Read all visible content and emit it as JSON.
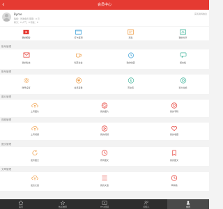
{
  "header": {
    "back_icon": "chevron-left-icon",
    "title": "会员中心"
  },
  "profile": {
    "name": "Byme",
    "line1": "等级：普通会员    蛋蛋：0 元",
    "line2": "积分：0   人气：0   粉丝：0",
    "edit_label": "完善资料信息"
  },
  "quick_actions": [
    {
      "label": "我的橱窗",
      "icon": "video-icon"
    },
    {
      "label": "打卡签到",
      "icon": "calendar-icon"
    },
    {
      "label": "消息",
      "icon": "message-icon"
    },
    {
      "label": "我的分享",
      "icon": "share-icon"
    }
  ],
  "sections": [
    {
      "title": "账号管理",
      "items": [
        {
          "label": "我的私信",
          "icon": "mail-icon"
        },
        {
          "label": "喝茶社会",
          "icon": "cup-icon"
        },
        {
          "label": "我的收藏",
          "icon": "history-icon"
        },
        {
          "label": "留言板",
          "icon": "message-icon"
        }
      ]
    },
    {
      "title": "账号管理",
      "items": [
        {
          "label": "账号设置",
          "icon": "gear-icon"
        },
        {
          "label": "会员变量",
          "icon": "heart-icon"
        },
        {
          "label": "币充值",
          "icon": "dollar-icon"
        },
        {
          "label": "积分兑换",
          "icon": "disk-icon"
        }
      ]
    },
    {
      "title": "图片管理",
      "items": [
        {
          "label": "上传图片",
          "icon": "upload-cloud-icon"
        },
        {
          "label": "我的图片",
          "icon": "aperture-icon"
        },
        {
          "label": "我的专辑",
          "icon": "heart-icon"
        }
      ]
    },
    {
      "title": "视频管理",
      "items": [
        {
          "label": "上传视频",
          "icon": "upload-cloud-icon"
        },
        {
          "label": "我的视频",
          "icon": "play-icon"
        },
        {
          "label": "我的收藏",
          "icon": "heart-icon"
        }
      ]
    },
    {
      "title": "图文管理",
      "items": [
        {
          "label": "发布图文",
          "icon": "refresh-icon"
        },
        {
          "label": "所有图文",
          "icon": "clock-icon"
        },
        {
          "label": "我的图文",
          "icon": "bookmark-icon"
        }
      ]
    },
    {
      "title": "文章管理",
      "items": [
        {
          "label": "发表文章",
          "icon": "upload-cloud-icon"
        },
        {
          "label": "我的文章",
          "icon": "list-icon"
        },
        {
          "label": "草稿箱",
          "icon": "clock-icon"
        }
      ]
    }
  ],
  "tabbar": [
    {
      "label": "首页",
      "icon": "home-icon"
    },
    {
      "label": "热点推荐",
      "icon": "star-icon"
    },
    {
      "label": "HT2视频",
      "icon": "video-icon"
    },
    {
      "label": "视频人",
      "icon": "users-icon"
    },
    {
      "label": "会员",
      "icon": "user-icon"
    }
  ],
  "colors": {
    "accent": "#e53a32",
    "icon_orange": "#f0a04b",
    "icon_teal": "#43b59c",
    "icon_blue": "#3aa0d8",
    "tabbar": "#2e2e2e"
  }
}
